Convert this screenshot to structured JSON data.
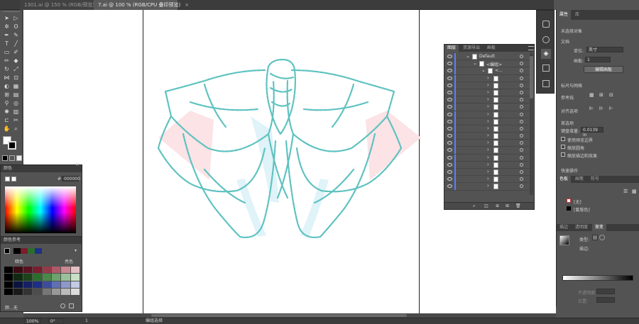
{
  "doc_tabs": [
    {
      "label": "1301.ai @ 150 % (RGB/预览)",
      "active": false
    },
    {
      "label": "7.ai @ 100 % (RGB/CPU 叠印预览)",
      "active": true
    }
  ],
  "status": {
    "zoom": "100%",
    "rotate": "0°",
    "page": "1",
    "tool": "编组选择"
  },
  "color_panel": {
    "title": "颜色",
    "hex": "000000"
  },
  "color_guide": {
    "title": "颜色参考",
    "dark_label": "暗色",
    "light_label": "亮色",
    "footer": "颜...无"
  },
  "layers": {
    "tabs": [
      "图层",
      "资源导出",
      "画板"
    ],
    "rows": [
      "Default",
      "<编组>",
      "<...",
      "",
      "",
      "",
      "",
      "",
      "",
      "",
      "",
      "",
      "",
      "",
      "",
      "",
      "",
      "",
      ""
    ]
  },
  "properties": {
    "tabs": [
      "属性",
      "库"
    ],
    "no_selection": "未选择对象",
    "doc_section": "文档",
    "units_label": "单位:",
    "units_value": "英寸",
    "artboard_label": "画板:",
    "artboard_value": "1",
    "edit_artboards": "编辑画板",
    "rulers_grid": "标尺与网格",
    "guides": "参考线",
    "align": "对齐选项",
    "prefs": "首选项",
    "key_increment_label": "键盘增量:",
    "key_increment_value": "0.0139 in",
    "opt1": "使用预览边界",
    "opt2": "缩放圆角",
    "opt3": "缩放描边和效果",
    "quick_actions": "快速操作"
  },
  "swatches_panel": {
    "tabs": [
      "色板",
      "画笔",
      "符号"
    ],
    "items": [
      "[无]",
      "[套版色]"
    ]
  },
  "gradient_panel": {
    "tabs": [
      "描边",
      "透明度",
      "渐变"
    ],
    "type_label": "类型:",
    "stroke_label": "描边:",
    "opacity_label": "不透明度:",
    "position_label": "位置:"
  },
  "colors": {
    "accent": "#5ec2c0",
    "layer_blue": "#5b7fff",
    "fill_light_blue": "#dff3f8",
    "fill_pink": "#fbe3e6"
  }
}
